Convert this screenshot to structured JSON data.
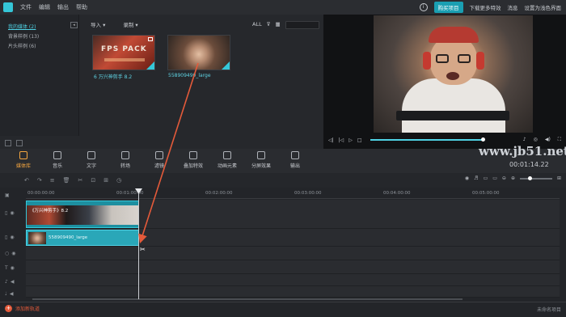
{
  "menu": {
    "items": [
      "文件",
      "编辑",
      "输出",
      "帮助"
    ]
  },
  "topright": {
    "buy": "购买项目",
    "download": "下载更多特效",
    "messages": "消息",
    "settings": "设置为浅色界面"
  },
  "library": {
    "items": [
      "我的媒体 (2)",
      "背景样例 (13)",
      "片头样例 (6)"
    ]
  },
  "media_toolbar": {
    "import": "导入 ▾",
    "record": "录制 ▾",
    "all": "ALL"
  },
  "media_items": [
    {
      "label": "6 万兴神剪手 8.2",
      "thumb_text": "FPS PACK"
    },
    {
      "label": "558909490_large"
    }
  ],
  "tools": [
    "媒体库",
    "音乐",
    "文字",
    "转场",
    "滤镜",
    "叠加特效",
    "动画元素",
    "分屏效果",
    "输出"
  ],
  "timecode": "00:01:14.22",
  "watermark": "www.jb51.net",
  "ruler": [
    "00:00:00:00",
    "00:01:00:00",
    "00:02:00:00",
    "00:03:00:00",
    "00:04:00:00",
    "00:05:00:00"
  ],
  "clips": {
    "video_title": "《万兴神剪手》8.2",
    "video2": "558909490_large"
  },
  "bottom": {
    "add_track": "添加新轨道",
    "project": "未命名项目"
  },
  "colors": {
    "accent": "#35c7d8",
    "active_tool": "#f4a640",
    "annotation_arrow": "#e45a3a"
  }
}
